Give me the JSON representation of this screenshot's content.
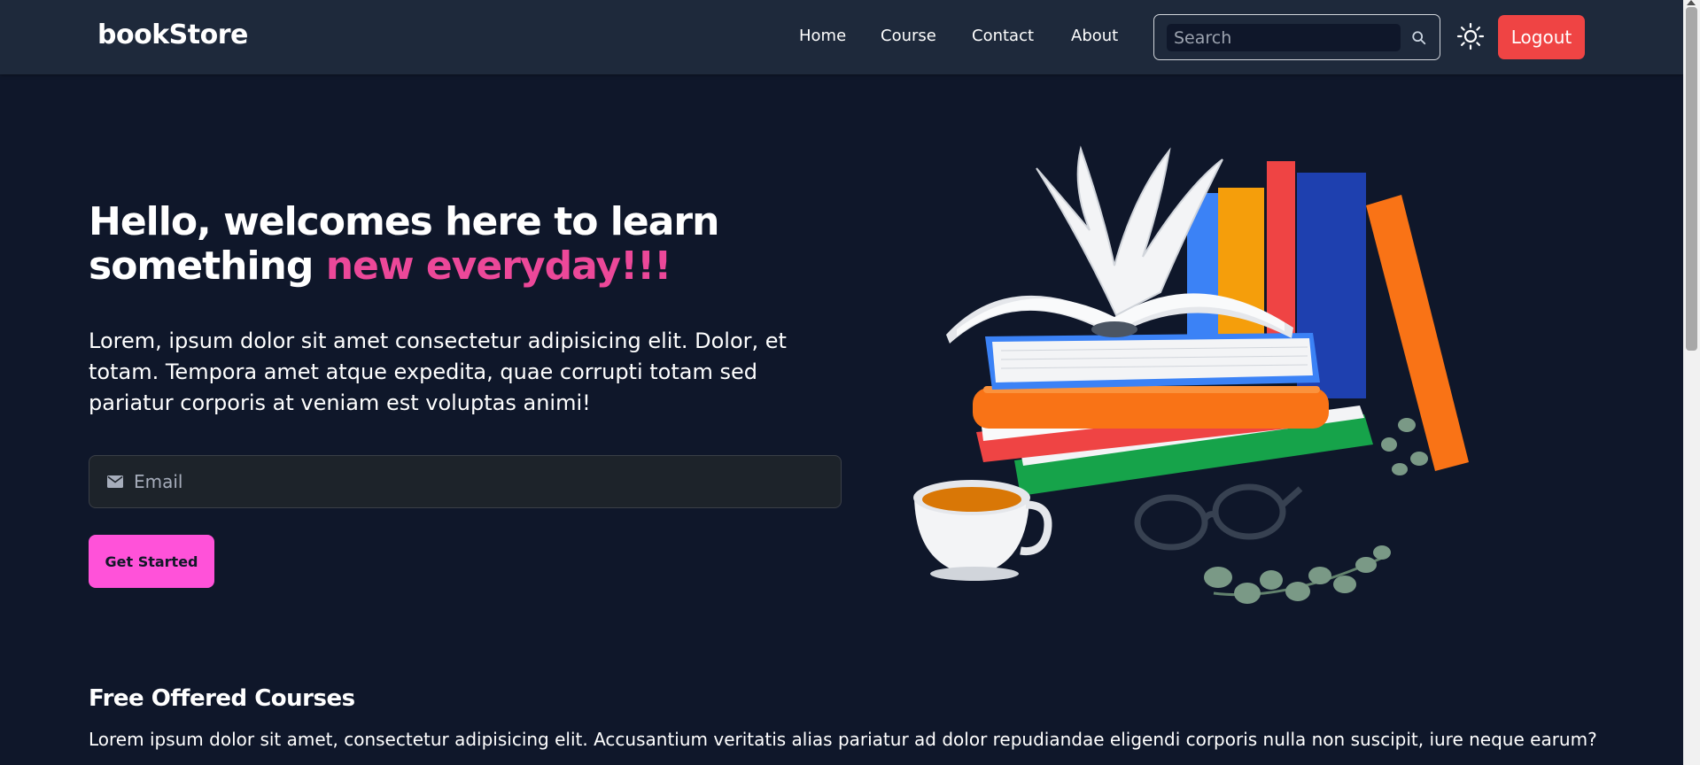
{
  "nav": {
    "brand": "bookStore",
    "links": [
      "Home",
      "Course",
      "Contact",
      "About"
    ],
    "search_placeholder": "Search",
    "logout_label": "Logout"
  },
  "hero": {
    "title_part1": "Hello, welcomes here to learn something",
    "title_accent": "new everyday!!!",
    "description": "Lorem, ipsum dolor sit amet consectetur adipisicing elit. Dolor, et totam. Tempora amet atque expedita, quae corrupti totam sed pariatur corporis at veniam est voluptas animi!",
    "email_placeholder": "Email",
    "cta_label": "Get Started"
  },
  "courses": {
    "title": "Free Offered Courses",
    "description": "Lorem ipsum dolor sit amet, consectetur adipisicing elit. Accusantium veritatis alias pariatur ad dolor repudiandae eligendi corporis nulla non suscipit, iure neque earum?"
  },
  "icons": {
    "search": "search-icon",
    "theme": "sun-icon",
    "email": "mail-icon"
  },
  "colors": {
    "background": "#0f172a",
    "navbar": "#1e293b",
    "accent_pink": "#ec4899",
    "cta": "#ff52d9",
    "logout": "#ef4444"
  }
}
